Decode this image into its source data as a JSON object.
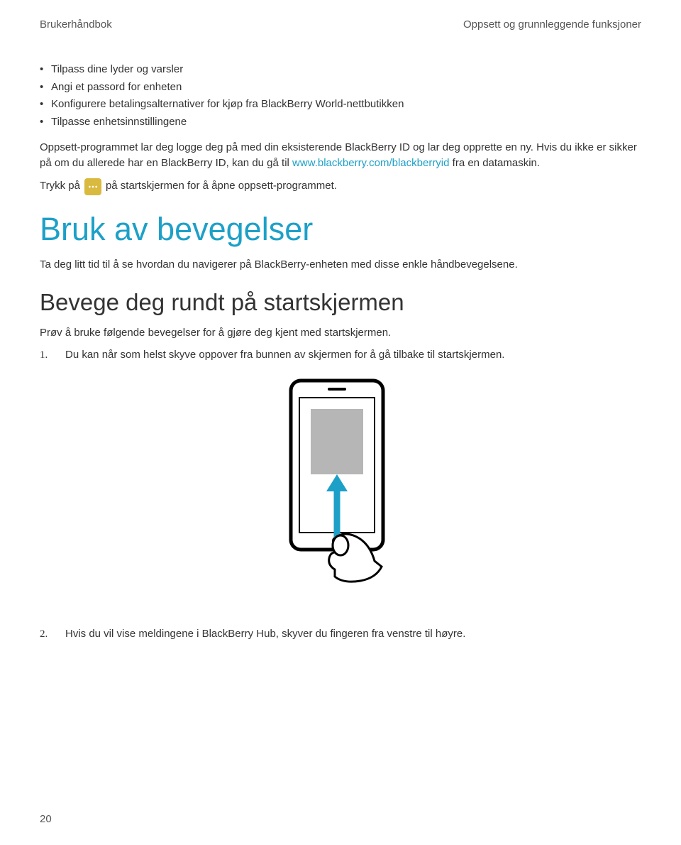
{
  "header": {
    "left": "Brukerhåndbok",
    "right": "Oppsett og grunnleggende funksjoner"
  },
  "bullets": [
    "Tilpass dine lyder og varsler",
    "Angi et passord for enheten",
    "Konfigurere betalingsalternativer for kjøp fra BlackBerry World-nettbutikken",
    "Tilpasse enhetsinnstillingene"
  ],
  "para1_before_link": "Oppsett-programmet lar deg logge deg på med din eksisterende BlackBerry ID og lar deg opprette en ny. Hvis du ikke er sikker på om du allerede har en BlackBerry ID, kan du gå til ",
  "para1_link": "www.blackberry.com/blackberryid",
  "para1_after_link": " fra en datamaskin.",
  "trykk_before": "Trykk på",
  "trykk_after": "på startskjermen for å åpne oppsett-programmet.",
  "icon_name": "setup-app-icon",
  "h1": "Bruk av bevegelser",
  "intro": "Ta deg litt tid til å se hvordan du navigerer på BlackBerry-enheten med disse enkle håndbevegelsene.",
  "h2": "Bevege deg rundt på startskjermen",
  "sub_intro": "Prøv å bruke følgende bevegelser for å gjøre deg kjent med startskjermen.",
  "step1_num": "1.",
  "step1_text": "Du kan når som helst skyve oppover fra bunnen av skjermen for å gå tilbake til startskjermen.",
  "step2_num": "2.",
  "step2_text": "Hvis du vil vise meldingene i BlackBerry Hub, skyver du fingeren fra venstre til høyre.",
  "page_number": "20"
}
